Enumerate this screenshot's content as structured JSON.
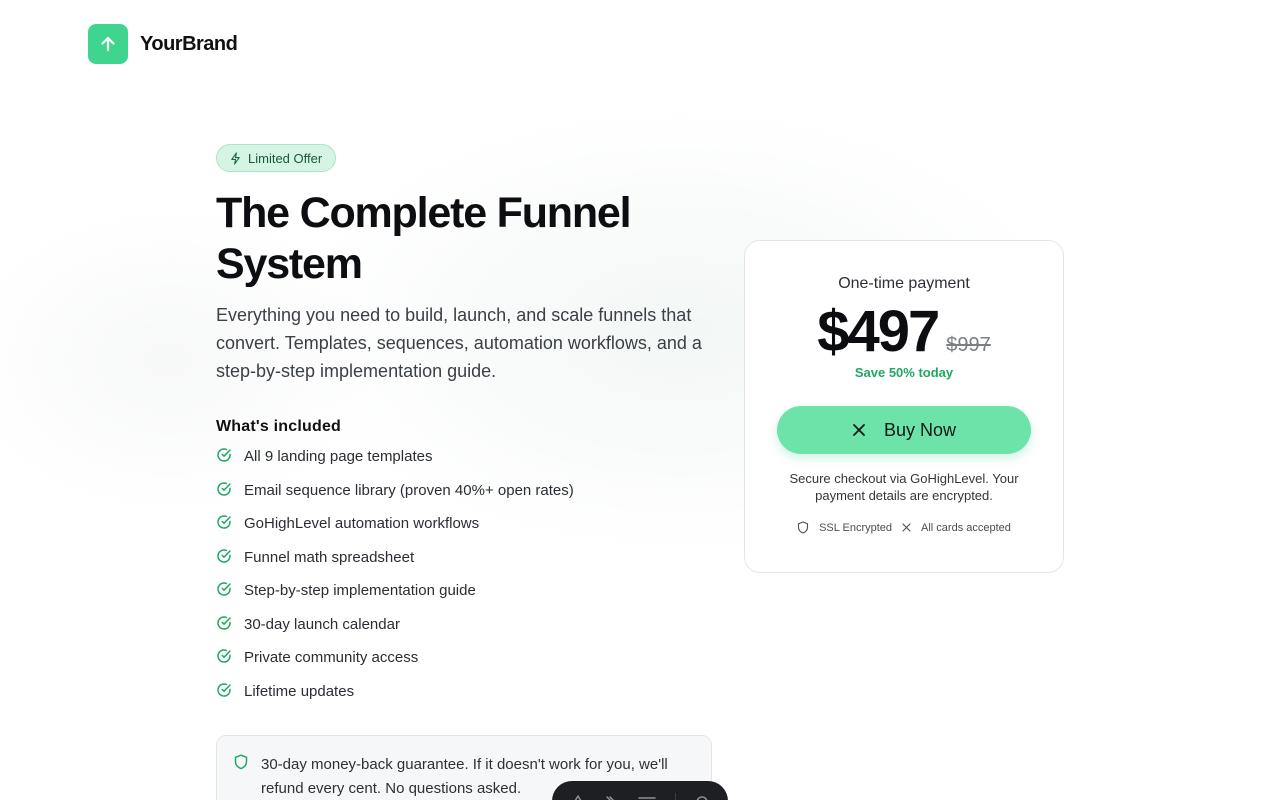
{
  "brand": {
    "name": "YourBrand",
    "logo_icon": "arrow-up-icon",
    "color": "#3fd58f"
  },
  "badge": {
    "label": "Limited Offer",
    "icon": "sparkle-icon"
  },
  "hero": {
    "title": "The Complete Funnel System",
    "subtitle": "Everything you need to build, launch, and scale funnels that convert. Templates, sequences, automation workflows, and a step-by-step implementation guide."
  },
  "included": {
    "title": "What's included",
    "items": [
      "All 9 landing page templates",
      "Email sequence library (proven 40%+ open rates)",
      "GoHighLevel automation workflows",
      "Funnel math spreadsheet",
      "Step-by-step implementation guide",
      "30-day launch calendar",
      "Private community access",
      "Lifetime updates"
    ]
  },
  "guarantee": {
    "text": "30-day money-back guarantee. If it doesn't work for you, we'll refund every cent. No questions asked."
  },
  "pricing": {
    "label": "One-time payment",
    "price": "$497",
    "old_price": "$997",
    "save_text": "Save 50% today",
    "button_label": "Buy Now",
    "secure_text": "Secure checkout via GoHighLevel. Your payment details are encrypted.",
    "trust_ssl": "SSL Encrypted",
    "trust_cards": "All cards accepted",
    "accent": "#6ee3a9",
    "save_color": "#1ea861"
  },
  "dock": {
    "icons": [
      "pen-icon",
      "brush-icon",
      "menu-icon",
      "gear-icon"
    ]
  }
}
